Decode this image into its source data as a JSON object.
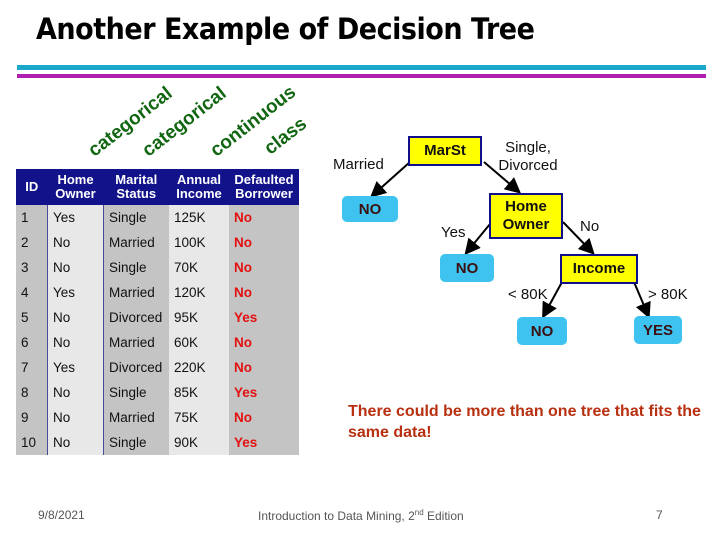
{
  "slide": {
    "title": "Another Example of Decision Tree",
    "accent_colors": {
      "cyan_bar": "#1ba7c9",
      "magenta_bar": "#b01faf"
    }
  },
  "column_types": [
    "categorical",
    "categorical",
    "continuous",
    "class"
  ],
  "table": {
    "headers": [
      [
        "ID"
      ],
      [
        "Home",
        "Owner"
      ],
      [
        "Marital",
        "Status"
      ],
      [
        "Annual",
        "Income"
      ],
      [
        "Defaulted",
        "Borrower"
      ]
    ],
    "rows": [
      [
        "1",
        "Yes",
        "Single",
        "125K",
        "No"
      ],
      [
        "2",
        "No",
        "Married",
        "100K",
        "No"
      ],
      [
        "3",
        "No",
        "Single",
        "70K",
        "No"
      ],
      [
        "4",
        "Yes",
        "Married",
        "120K",
        "No"
      ],
      [
        "5",
        "No",
        "Divorced",
        "95K",
        "Yes"
      ],
      [
        "6",
        "No",
        "Married",
        "60K",
        "No"
      ],
      [
        "7",
        "Yes",
        "Divorced",
        "220K",
        "No"
      ],
      [
        "8",
        "No",
        "Single",
        "85K",
        "Yes"
      ],
      [
        "9",
        "No",
        "Married",
        "75K",
        "No"
      ],
      [
        "10",
        "No",
        "Single",
        "90K",
        "Yes"
      ]
    ]
  },
  "tree": {
    "root": "MarSt",
    "root_left_edge": "Married",
    "root_right_edge": [
      "Single,",
      "Divorced"
    ],
    "leaf_married": "NO",
    "home_owner": [
      "Home",
      "Owner"
    ],
    "home_yes_edge": "Yes",
    "home_no_edge": "No",
    "leaf_home_yes": "NO",
    "income": "Income",
    "income_left_edge": "< 80K",
    "income_right_edge": "> 80K",
    "leaf_income_low": "NO",
    "leaf_income_high": "YES"
  },
  "note": "There could be more than one tree that fits the same data!",
  "footer": {
    "date": "9/8/2021",
    "course_prefix": "Introduction to Data Mining, 2",
    "course_sup": "nd",
    "course_suffix": " Edition",
    "page": "7"
  }
}
